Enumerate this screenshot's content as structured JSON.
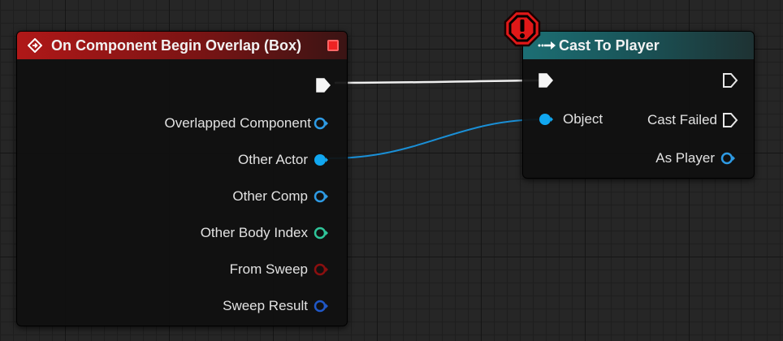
{
  "event_node": {
    "title": "On Component Begin Overlap (Box)",
    "header_color": "#b01818",
    "pins": [
      {
        "label": "",
        "type": "exec",
        "connected": true
      },
      {
        "label": "Overlapped Component",
        "type": "object-ref",
        "color": "#2e9be5",
        "connected": false
      },
      {
        "label": "Other Actor",
        "type": "object-ref",
        "color": "#11a7f0",
        "connected": true
      },
      {
        "label": "Other Comp",
        "type": "object-ref",
        "color": "#2e9be5",
        "connected": false
      },
      {
        "label": "Other Body Index",
        "type": "integer",
        "color": "#2fc59a",
        "connected": false
      },
      {
        "label": "From Sweep",
        "type": "boolean",
        "color": "#8b0f0f",
        "connected": false
      },
      {
        "label": "Sweep Result",
        "type": "struct",
        "color": "#2058c8",
        "connected": false
      }
    ]
  },
  "cast_node": {
    "title": "Cast To Player",
    "header_color": "#1c6f74",
    "status_icon": "error-icon",
    "status_color": "#e01818",
    "inputs": [
      {
        "label": "",
        "type": "exec",
        "connected": true
      },
      {
        "label": "Object",
        "type": "object-ref",
        "color": "#11a7f0",
        "connected": true
      }
    ],
    "outputs": [
      {
        "label": "",
        "type": "exec",
        "connected": false
      },
      {
        "label": "Cast Failed",
        "type": "exec",
        "connected": false
      },
      {
        "label": "As Player",
        "type": "object-ref",
        "color": "#2e9be5",
        "connected": false
      }
    ]
  },
  "wires": [
    {
      "from": "event_node.exec",
      "to": "cast_node.exec",
      "color": "#f0f0f0"
    },
    {
      "from": "event_node.Other Actor",
      "to": "cast_node.Object",
      "color": "#1a8fd6"
    }
  ]
}
